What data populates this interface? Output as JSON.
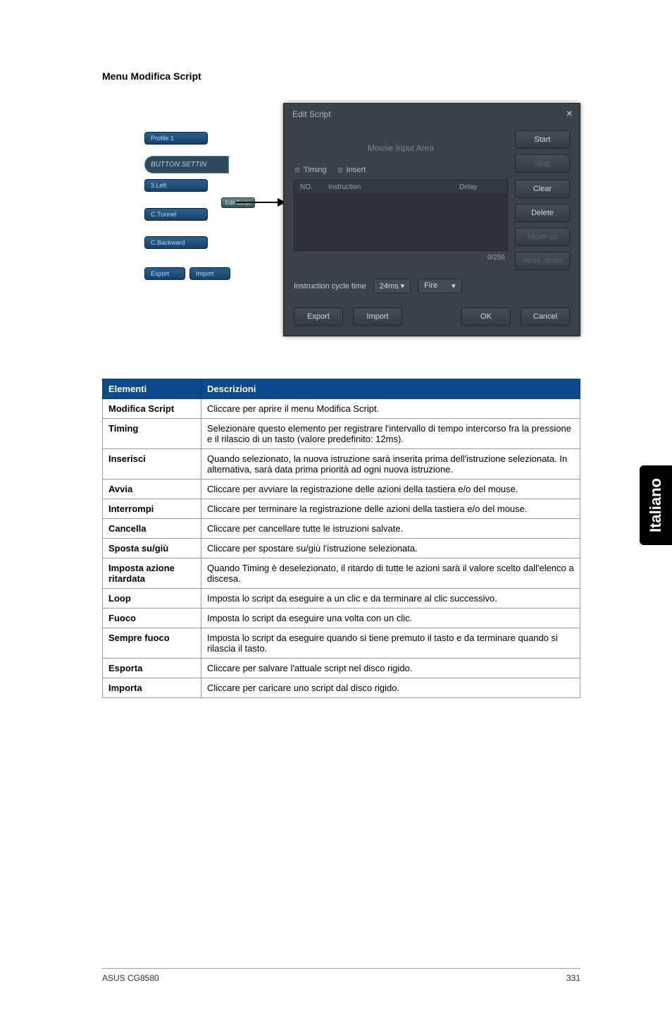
{
  "section_title": "Menu Modifica Script",
  "sidetab": "Italiano",
  "footer_left": "ASUS CG8580",
  "footer_right": "331",
  "left_panel": {
    "profile": "Profile 1",
    "banner": "BUTTON SETTIN",
    "btn1": "3.Left",
    "btn2": "Edit Script",
    "btn3": "C.Tunnel",
    "btn4": "C.Backward",
    "btn5a": "Export",
    "btn5b": "Import"
  },
  "dialog": {
    "title": "Edit Script",
    "input_area": "Mouse Input Area",
    "timing": "Timing",
    "insert": "Insert",
    "col_no": "NO.",
    "col_instr": "Instruction",
    "col_delay": "Delay",
    "counter": "0/256",
    "cycle_label": "Instruction cycle time",
    "cycle_value": "24ms ▾",
    "fire": "Fire",
    "fire_caret": "▾",
    "export": "Export",
    "import": "Import",
    "ok": "OK",
    "cancel": "Cancel",
    "start": "Start",
    "stop": "Stop",
    "clear": "Clear",
    "delete": "Delete",
    "moveup": "Move up",
    "movedown": "Move down"
  },
  "table": {
    "h1": "Elementi",
    "h2": "Descrizioni",
    "rows": [
      {
        "k": "Modifica Script",
        "v": "Cliccare per aprire il menu Modifica Script."
      },
      {
        "k": "Timing",
        "v": "Selezionare questo elemento per registrare l'intervallo di tempo intercorso fra la pressione e il rilascio di un tasto (valore predefinito: 12ms)."
      },
      {
        "k": "Inserisci",
        "v": "Quando selezionato, la nuova istruzione sarà inserita prima dell'istruzione selezionata. In alternativa, sarà data prima priorità ad ogni nuova istruzione."
      },
      {
        "k": "Avvia",
        "v": "Cliccare per avviare la registrazione delle azioni della tastiera e/o del mouse."
      },
      {
        "k": "Interrompi",
        "v": "Cliccare per terminare la registrazione delle azioni della tastiera e/o del mouse."
      },
      {
        "k": "Cancella",
        "v": "Cliccare per cancellare tutte le istruzioni salvate."
      },
      {
        "k": "Sposta su/giù",
        "v": "Cliccare per spostare su/giù l'istruzione selezionata."
      },
      {
        "k": "Imposta azione ritardata",
        "v": "Quando Timing è deselezionato, il ritardo di tutte le azioni sarà il valore scelto dall'elenco a discesa."
      },
      {
        "k": "Loop",
        "v": "Imposta lo script da eseguire a un clic e da terminare al clic successivo."
      },
      {
        "k": "Fuoco",
        "v": "Imposta  lo script da eseguire una volta con un clic."
      },
      {
        "k": "Sempre fuoco",
        "v": "Imposta lo script da eseguire quando si tiene premuto il tasto e da terminare quando si rilascia il tasto."
      },
      {
        "k": "Esporta",
        "v": "Cliccare per salvare l'attuale script nel disco rigido."
      },
      {
        "k": "Importa",
        "v": "Cliccare per caricare uno script dal disco rigido."
      }
    ]
  }
}
